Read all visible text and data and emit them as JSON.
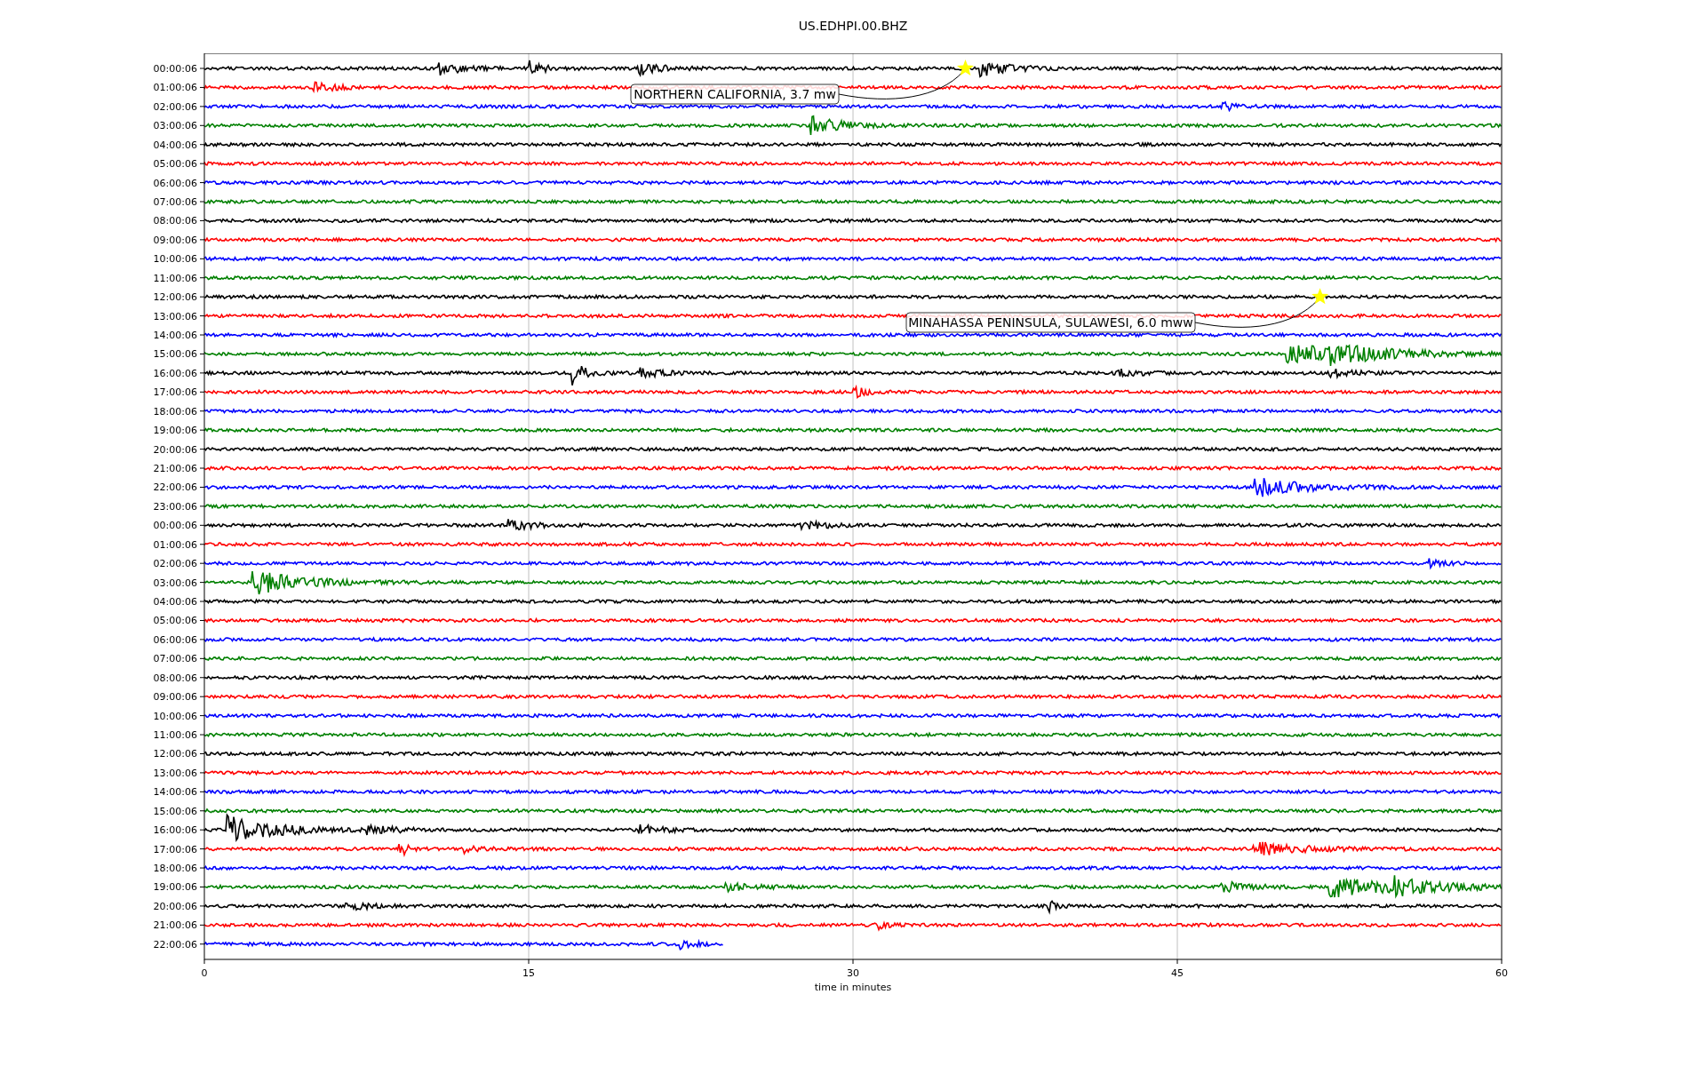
{
  "title": "US.EDHPI.00.BHZ",
  "plot": {
    "xlabel": "time in minutes",
    "xticks": [
      "0",
      "15",
      "30",
      "45",
      "60"
    ],
    "traces": [
      {
        "label": "00:00:06",
        "color": "#000000"
      },
      {
        "label": "01:00:06",
        "color": "#ff0000"
      },
      {
        "label": "02:00:06",
        "color": "#0000ff"
      },
      {
        "label": "03:00:06",
        "color": "#008000"
      },
      {
        "label": "04:00:06",
        "color": "#000000"
      },
      {
        "label": "05:00:06",
        "color": "#ff0000"
      },
      {
        "label": "06:00:06",
        "color": "#0000ff"
      },
      {
        "label": "07:00:06",
        "color": "#008000"
      },
      {
        "label": "08:00:06",
        "color": "#000000"
      },
      {
        "label": "09:00:06",
        "color": "#ff0000"
      },
      {
        "label": "10:00:06",
        "color": "#0000ff"
      },
      {
        "label": "11:00:06",
        "color": "#008000"
      },
      {
        "label": "12:00:06",
        "color": "#000000"
      },
      {
        "label": "13:00:06",
        "color": "#ff0000"
      },
      {
        "label": "14:00:06",
        "color": "#0000ff"
      },
      {
        "label": "15:00:06",
        "color": "#008000"
      },
      {
        "label": "16:00:06",
        "color": "#000000"
      },
      {
        "label": "17:00:06",
        "color": "#ff0000"
      },
      {
        "label": "18:00:06",
        "color": "#0000ff"
      },
      {
        "label": "19:00:06",
        "color": "#008000"
      },
      {
        "label": "20:00:06",
        "color": "#000000"
      },
      {
        "label": "21:00:06",
        "color": "#ff0000"
      },
      {
        "label": "22:00:06",
        "color": "#0000ff"
      },
      {
        "label": "23:00:06",
        "color": "#008000"
      },
      {
        "label": "00:00:06",
        "color": "#000000"
      },
      {
        "label": "01:00:06",
        "color": "#ff0000"
      },
      {
        "label": "02:00:06",
        "color": "#0000ff"
      },
      {
        "label": "03:00:06",
        "color": "#008000"
      },
      {
        "label": "04:00:06",
        "color": "#000000"
      },
      {
        "label": "05:00:06",
        "color": "#ff0000"
      },
      {
        "label": "06:00:06",
        "color": "#0000ff"
      },
      {
        "label": "07:00:06",
        "color": "#008000"
      },
      {
        "label": "08:00:06",
        "color": "#000000"
      },
      {
        "label": "09:00:06",
        "color": "#ff0000"
      },
      {
        "label": "10:00:06",
        "color": "#0000ff"
      },
      {
        "label": "11:00:06",
        "color": "#008000"
      },
      {
        "label": "12:00:06",
        "color": "#000000"
      },
      {
        "label": "13:00:06",
        "color": "#ff0000"
      },
      {
        "label": "14:00:06",
        "color": "#0000ff"
      },
      {
        "label": "15:00:06",
        "color": "#008000"
      },
      {
        "label": "16:00:06",
        "color": "#000000"
      },
      {
        "label": "17:00:06",
        "color": "#ff0000"
      },
      {
        "label": "18:00:06",
        "color": "#0000ff"
      },
      {
        "label": "19:00:06",
        "color": "#008000"
      },
      {
        "label": "20:00:06",
        "color": "#000000"
      },
      {
        "label": "21:00:06",
        "color": "#ff0000"
      },
      {
        "label": "22:00:06",
        "color": "#0000ff"
      }
    ],
    "events": [
      {
        "label": "NORTHERN CALIFORNIA, 3.7 mw"
      },
      {
        "label": "MINAHASSA PENINSULA, SULAWESI, 6.0 mww"
      }
    ]
  }
}
